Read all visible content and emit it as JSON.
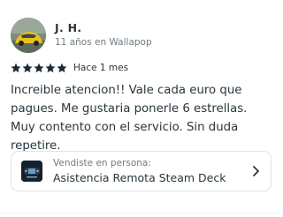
{
  "reviewer": {
    "name": "J. H.",
    "meta": "11 años en Wallapop",
    "avatar_icon": "car-photo-avatar"
  },
  "rating": {
    "stars": 5,
    "max": 5,
    "star_color": "#1b2a33",
    "date": "Hace 1 mes"
  },
  "review": {
    "text": "Increible atencion!! Vale cada euro que pagues. Me gustaria ponerle 6 estrellas.  Muy contento con el servicio. Sin duda repetire."
  },
  "item": {
    "label": "Vendiste en persona:",
    "title": "Asistencia Remota Steam Deck",
    "thumb_icon": "steam-deck-thumbnail",
    "action_icon": "chevron-right-icon"
  },
  "colors": {
    "text_primary": "#29363d",
    "text_secondary": "#6e7b82",
    "border": "#dfe3e6"
  }
}
